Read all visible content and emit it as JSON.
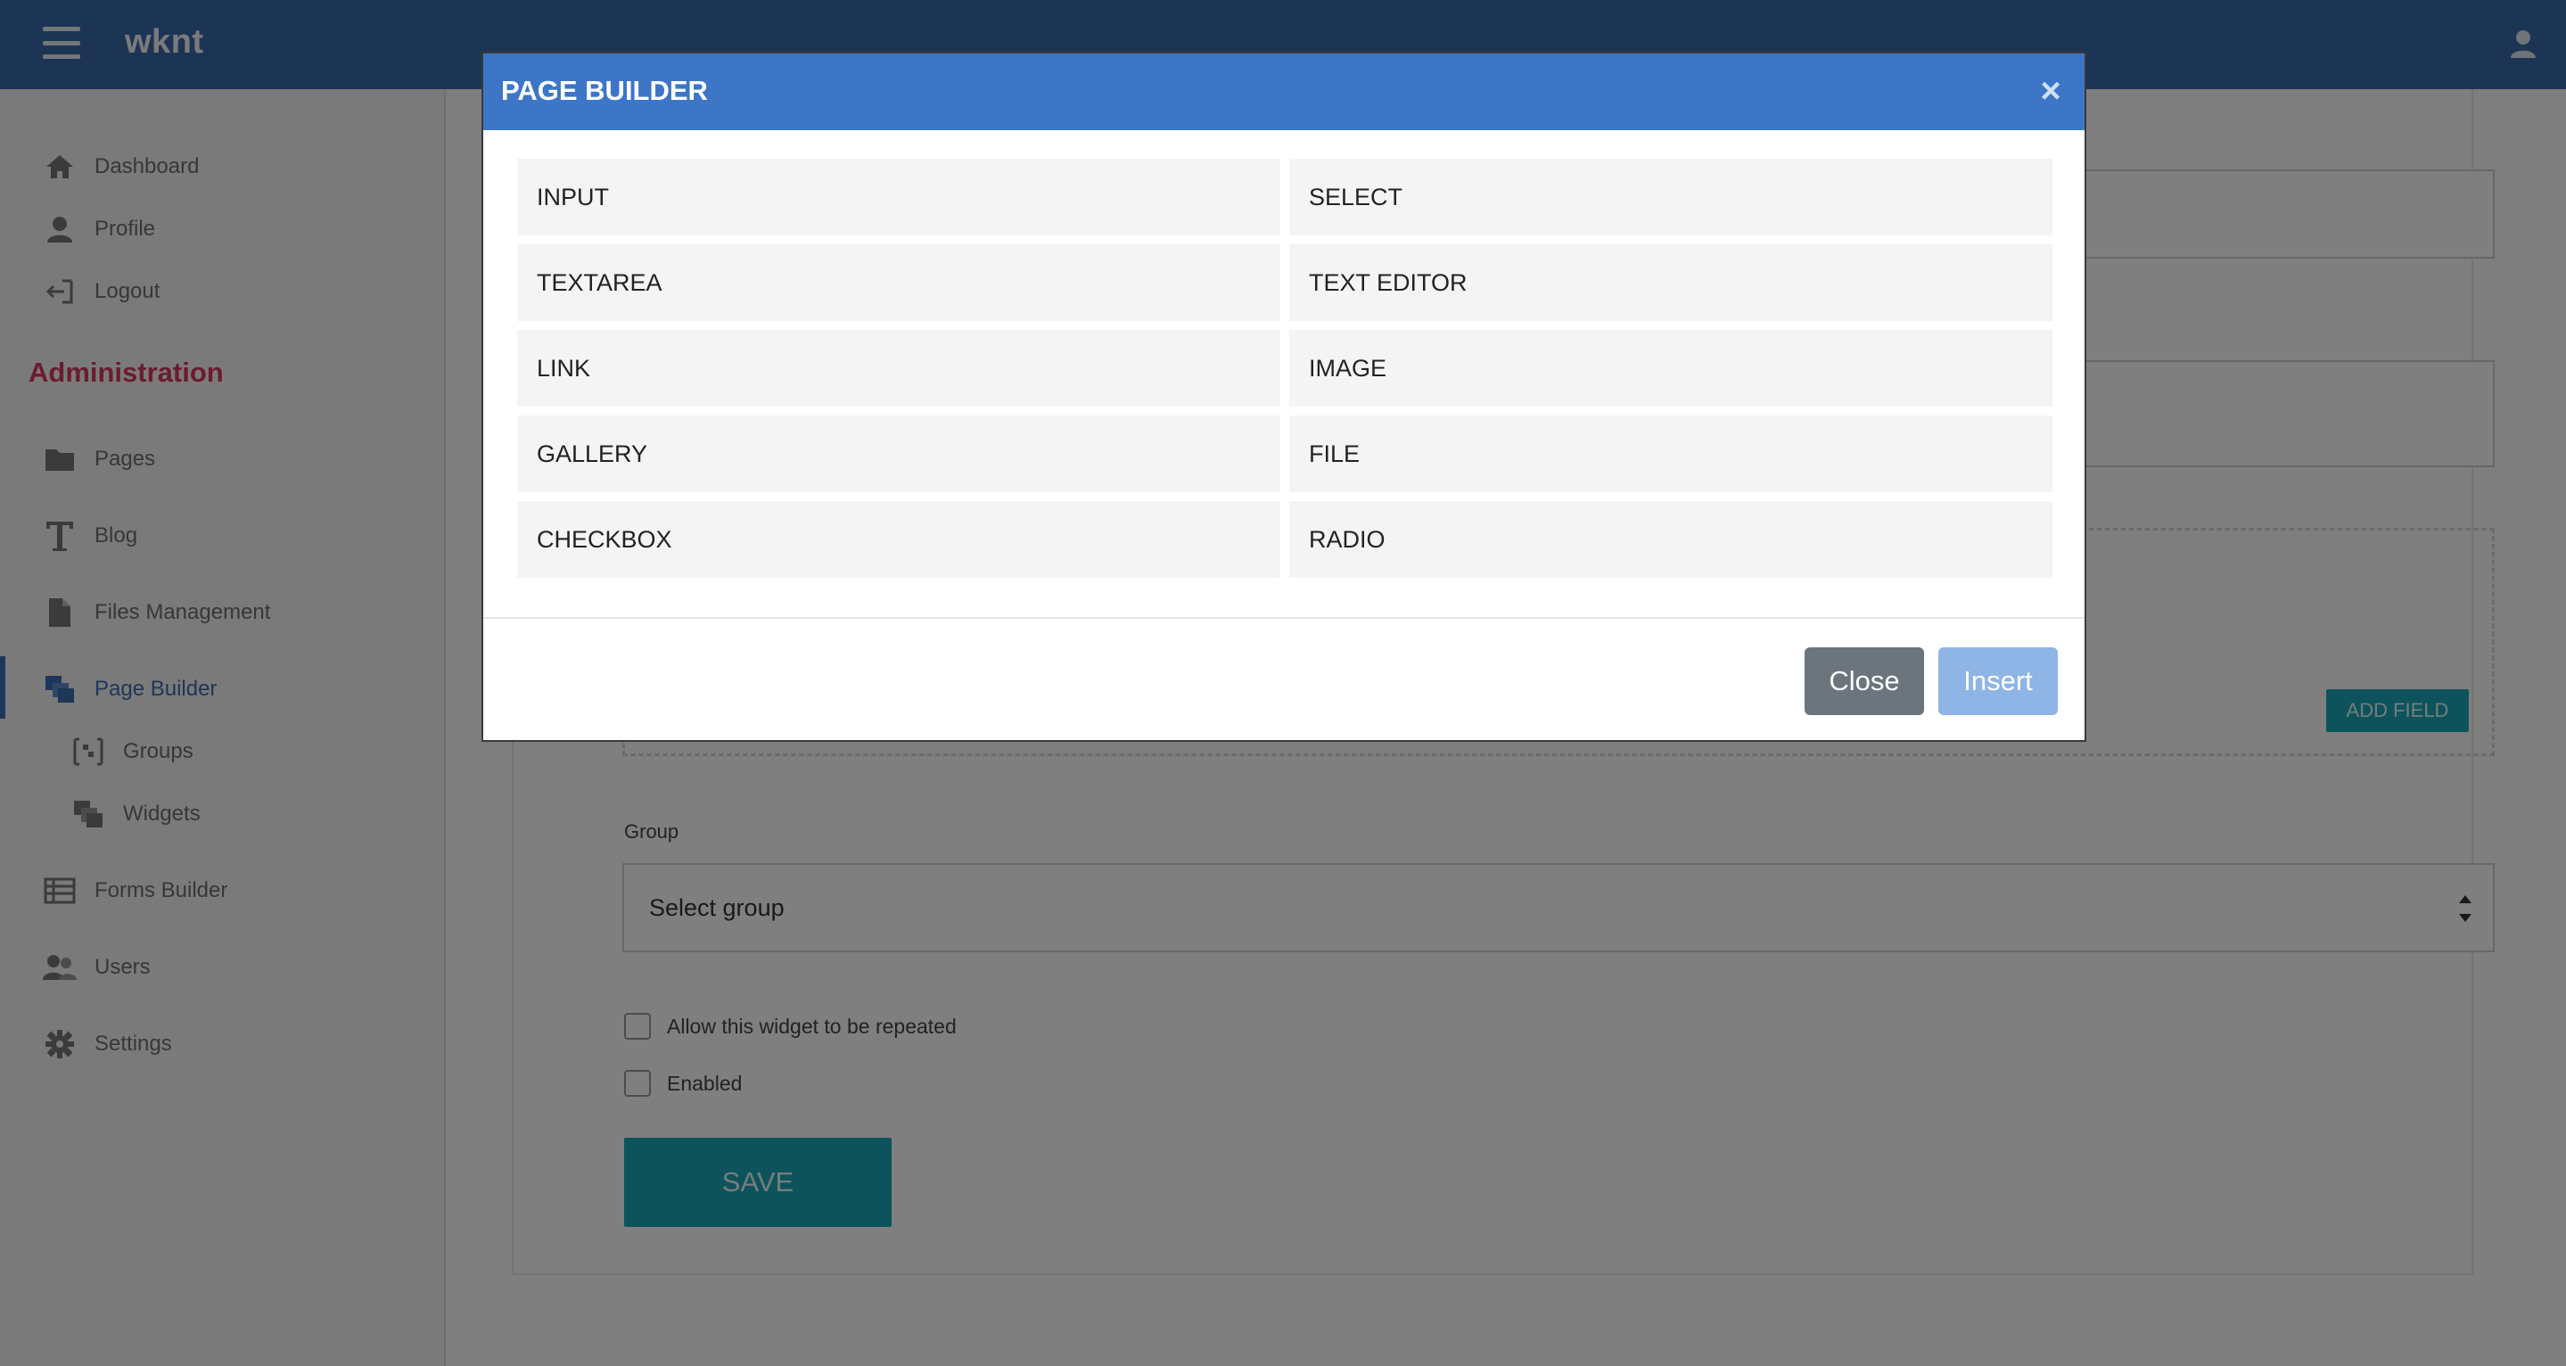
{
  "app": {
    "title": "wknt"
  },
  "icons": {
    "menu": "hamburger-menu-icon",
    "user": "user-icon",
    "close": "close-icon"
  },
  "colors": {
    "topbar": "#3a6aa8",
    "admin_heading": "#d8365f",
    "active_nav": "#3d6fb1",
    "modal_header": "#3d76c6",
    "primary_teal": "#1aa6b7",
    "close_button": "#6c757d",
    "insert_button": "#8fb4e6"
  },
  "sidebar": {
    "top_items": [
      {
        "label": "Dashboard",
        "icon": "home-icon"
      },
      {
        "label": "Profile",
        "icon": "user-icon"
      },
      {
        "label": "Logout",
        "icon": "logout-icon"
      }
    ],
    "section_title": "Administration",
    "admin_items": [
      {
        "label": "Pages",
        "icon": "folder-icon"
      },
      {
        "label": "Blog",
        "icon": "text-icon"
      },
      {
        "label": "Files Management",
        "icon": "file-icon"
      },
      {
        "label": "Page Builder",
        "icon": "layers-icon",
        "active": true
      },
      {
        "label": "Groups",
        "icon": "group-bracket-icon"
      },
      {
        "label": "Widgets",
        "icon": "layers-icon"
      },
      {
        "label": "Forms Builder",
        "icon": "list-icon"
      },
      {
        "label": "Users",
        "icon": "users-icon"
      },
      {
        "label": "Settings",
        "icon": "gear-icon"
      }
    ]
  },
  "main": {
    "add_field_label": "ADD FIELD",
    "group_label": "Group",
    "group_select_value": "Select group",
    "checkbox_repeat_label": "Allow this widget to be repeated",
    "checkbox_enabled_label": "Enabled",
    "save_label": "SAVE"
  },
  "modal": {
    "title": "PAGE BUILDER",
    "close_glyph": "×",
    "options": [
      "INPUT",
      "SELECT",
      "TEXTAREA",
      "TEXT EDITOR",
      "LINK",
      "IMAGE",
      "GALLERY",
      "FILE",
      "CHECKBOX",
      "RADIO"
    ],
    "close_label": "Close",
    "insert_label": "Insert"
  }
}
